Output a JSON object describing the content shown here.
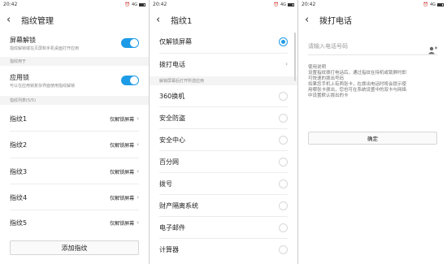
{
  "colors": {
    "accent": "#1e9be6",
    "section_bg": "#f4f4f4",
    "sub_text": "#8a8a8a"
  },
  "screen1": {
    "status": {
      "time": "20:42",
      "signal": "4G"
    },
    "title": "指纹管理",
    "screen_lock": {
      "label": "屏幕解锁",
      "sub": "指纹解锁或在灭屏和手机桌面打开应用",
      "enabled": true
    },
    "section_usage": "指纹用于",
    "app_lock": {
      "label": "应用锁",
      "sub": "可以在应用锁复杂界面使用指纹解锁",
      "enabled": true
    },
    "section_list": "指纹列表(5/5)",
    "fingerprints": [
      {
        "name": "指纹1",
        "action": "仅解锁屏幕"
      },
      {
        "name": "指纹2",
        "action": "仅解锁屏幕"
      },
      {
        "name": "指纹3",
        "action": "仅解锁屏幕"
      },
      {
        "name": "指纹4",
        "action": "仅解锁屏幕"
      },
      {
        "name": "指纹5",
        "action": "仅解锁屏幕"
      }
    ],
    "add_button": "添加指纹"
  },
  "screen2": {
    "status": {
      "time": "20:42",
      "signal": "4G"
    },
    "title": "指纹1",
    "options": [
      {
        "label": "仅解锁屏幕",
        "selected": true
      },
      {
        "label": "拨打电话",
        "chevron": true
      }
    ],
    "section": "解锁屏幕后打开所选应用",
    "apps": [
      "360换机",
      "安全防盗",
      "安全中心",
      "百分网",
      "拨号",
      "财产隔离系统",
      "电子邮件",
      "计算器"
    ]
  },
  "screen3": {
    "status": {
      "time": "20:42",
      "signal": "4G"
    },
    "title": "拨打电话",
    "input_placeholder": "请输入电话号码",
    "help_lines": [
      "使用说明",
      "设置指纹拨打电话后，通过指纹在待机或锁屏时即",
      "可快速的拨出号码",
      "如果您手机上有两张卡，在拨出电话时将会提示使",
      "用哪张卡拨出，您也可在系统设置中的双卡与网络",
      "中设置默认拨出的卡"
    ],
    "confirm_button": "确定"
  }
}
